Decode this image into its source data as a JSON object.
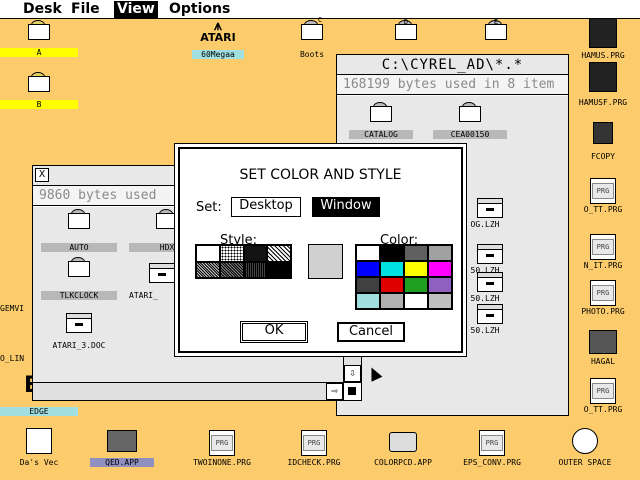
{
  "menu": [
    "Desk",
    "File",
    "View",
    "Options"
  ],
  "desktop": {
    "drive_a": "A",
    "drive_b": "B",
    "drive_c": "C",
    "drive_d": "D",
    "drive_e": "E",
    "atari_logo": "ATARI",
    "drive_60mega": "60Megaa",
    "boots": "Boots",
    "hamus": "HAMUS.PRG",
    "hamusf": "HAMUSF.PRG",
    "fcopy": "FCOPY",
    "o_tt": "O_TT.PRG",
    "n_it": "N_IT.PRG",
    "photo": "PHOTO.PRG",
    "hagal": "HAGAL",
    "o_tt2": "O_TT.PRG",
    "gemvi": "GEMVI",
    "o_lin": "O_LIN",
    "edge": "EDGE",
    "edge_big": "E",
    "das_vec": "Da's Vec",
    "qed": "QED.APP",
    "twoinone": "TWOINONE.PRG",
    "idcheck": "IDCHECK.PRG",
    "colorpcd": "COLORPCD.APP",
    "eps_conv": "EPS_CONV.PRG",
    "outer_space": "OUTER SPACE",
    "prg_tag": "PRG"
  },
  "window_c": {
    "title": "C:\\CYREL_AD\\*.*",
    "info": "168199 bytes used in 8 item",
    "items": [
      "CATALOG",
      "CEA00150",
      "OG.LZH",
      "50.LZH",
      "50.LZH",
      "50.LZH"
    ]
  },
  "window_b": {
    "close": "X",
    "info": "9860 bytes used",
    "items": [
      "AUTO",
      "HDX",
      "TLKCLOCK",
      "ATARI_",
      "ATARI_3.DOC"
    ],
    "scroll_down": "⇩",
    "scroll_right": "⇨"
  },
  "dialog": {
    "title": "SET COLOR AND STYLE",
    "set_label": "Set:",
    "desktop_btn": "Desktop",
    "window_btn": "Window",
    "style_label": "Style:",
    "color_label": "Color:",
    "ok": "OK",
    "cancel": "Cancel",
    "colors": [
      "#ffffff",
      "#000000",
      "#606060",
      "#a0a0a0",
      "#0000ff",
      "#00e0e0",
      "#ffff00",
      "#ff00ff",
      "#404040",
      "#e00000",
      "#20a020",
      "#9060c0",
      "#a0e0e0",
      "#b0b0b0",
      "#ffffff",
      "#c0c0c0"
    ]
  }
}
